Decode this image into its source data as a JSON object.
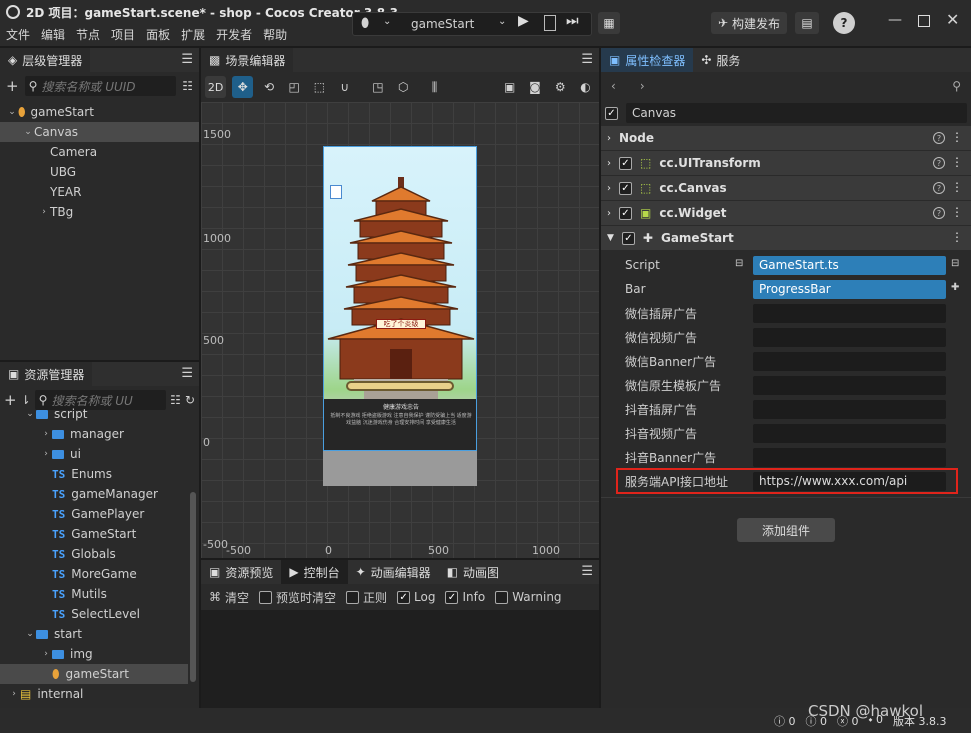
{
  "window": {
    "title": "2D 项目：gameStart.scene* - shop - Cocos Creator 3.8.3",
    "menu": [
      "文件",
      "编辑",
      "节点",
      "项目",
      "面板",
      "扩展",
      "开发者",
      "帮助"
    ],
    "scene_select": "gameStart",
    "publish_button": "构建发布"
  },
  "hierarchy": {
    "tab": "层级管理器",
    "search_placeholder": "搜索名称或 UUID",
    "nodes": [
      {
        "label": "gameStart",
        "depth": 0,
        "caret": "down",
        "icon": "scene"
      },
      {
        "label": "Canvas",
        "depth": 1,
        "caret": "down",
        "selected": true
      },
      {
        "label": "Camera",
        "depth": 2
      },
      {
        "label": "UBG",
        "depth": 2
      },
      {
        "label": "YEAR",
        "depth": 2
      },
      {
        "label": "TBg",
        "depth": 2,
        "caret": "right"
      }
    ]
  },
  "assets": {
    "tab": "资源管理器",
    "search_placeholder": "搜索名称或 UU",
    "items": [
      {
        "label": "script",
        "depth": 1,
        "type": "folder",
        "caret": "down"
      },
      {
        "label": "manager",
        "depth": 2,
        "type": "folder",
        "caret": "right"
      },
      {
        "label": "ui",
        "depth": 2,
        "type": "folder",
        "caret": "right"
      },
      {
        "label": "Enums",
        "depth": 2,
        "type": "ts"
      },
      {
        "label": "gameManager",
        "depth": 2,
        "type": "ts"
      },
      {
        "label": "GamePlayer",
        "depth": 2,
        "type": "ts"
      },
      {
        "label": "GameStart",
        "depth": 2,
        "type": "ts"
      },
      {
        "label": "Globals",
        "depth": 2,
        "type": "ts"
      },
      {
        "label": "MoreGame",
        "depth": 2,
        "type": "ts"
      },
      {
        "label": "Mutils",
        "depth": 2,
        "type": "ts"
      },
      {
        "label": "SelectLevel",
        "depth": 2,
        "type": "ts"
      },
      {
        "label": "start",
        "depth": 1,
        "type": "folder",
        "caret": "down"
      },
      {
        "label": "img",
        "depth": 2,
        "type": "folder",
        "caret": "right"
      },
      {
        "label": "gameStart",
        "depth": 2,
        "type": "scene",
        "selected": true
      },
      {
        "label": "internal",
        "depth": 0,
        "type": "db",
        "caret": "right"
      }
    ]
  },
  "scene": {
    "tab": "场景编辑器",
    "mode_2d": "2D",
    "y_labels": [
      "1500",
      "1000",
      "500",
      "0",
      "-500"
    ],
    "x_labels": [
      "-500",
      "0",
      "500",
      "1000"
    ],
    "game_banner": "吃了个炎级",
    "game_footer_title": "健康游戏忠告",
    "game_footer_text": "抵制不良游戏 拒绝盗版游戏 注意自我保护 谨防受骗上当 适度游戏益脑 沉迷游戏伤身 合理安排时间 享受健康生活"
  },
  "console": {
    "tabs": [
      "资源预览",
      "控制台",
      "动画编辑器",
      "动画图"
    ],
    "active_tab": "控制台",
    "clear": "清空",
    "filters": [
      {
        "label": "预览时清空",
        "checked": false
      },
      {
        "label": "正则",
        "checked": false
      },
      {
        "label": "Log",
        "checked": true
      },
      {
        "label": "Info",
        "checked": true
      },
      {
        "label": "Warning",
        "checked": false
      }
    ]
  },
  "inspector": {
    "tabs": [
      "属性检查器",
      "服务"
    ],
    "node_name": "Canvas",
    "sections": [
      {
        "label": "Node",
        "check": false,
        "icon": ""
      },
      {
        "label": "cc.UITransform",
        "check": true,
        "icon": "transform"
      },
      {
        "label": "cc.Canvas",
        "check": true,
        "icon": "canvas"
      },
      {
        "label": "cc.Widget",
        "check": true,
        "icon": "widget"
      }
    ],
    "component": "GameStart",
    "props": [
      {
        "label": "Script",
        "value": "GameStart.ts",
        "asset": true
      },
      {
        "label": "Bar",
        "value": "ProgressBar",
        "asset": true
      },
      {
        "label": "微信插屏广告",
        "value": ""
      },
      {
        "label": "微信视频广告",
        "value": ""
      },
      {
        "label": "微信Banner广告",
        "value": ""
      },
      {
        "label": "微信原生模板广告",
        "value": ""
      },
      {
        "label": "抖音插屏广告",
        "value": ""
      },
      {
        "label": "抖音视频广告",
        "value": ""
      },
      {
        "label": "抖音Banner广告",
        "value": ""
      },
      {
        "label": "服务端API接口地址",
        "value": "https://www.xxx.com/api",
        "highlight": true
      }
    ],
    "add_component": "添加组件"
  },
  "statusbar": {
    "counts": [
      "0",
      "0",
      "0",
      "0"
    ],
    "version": "版本 3.8.3",
    "watermark": "CSDN @hawkol"
  },
  "colors": {
    "accent": "#2d7fb8",
    "highlight": "#e0241b",
    "bg": "#2a2a2a"
  }
}
